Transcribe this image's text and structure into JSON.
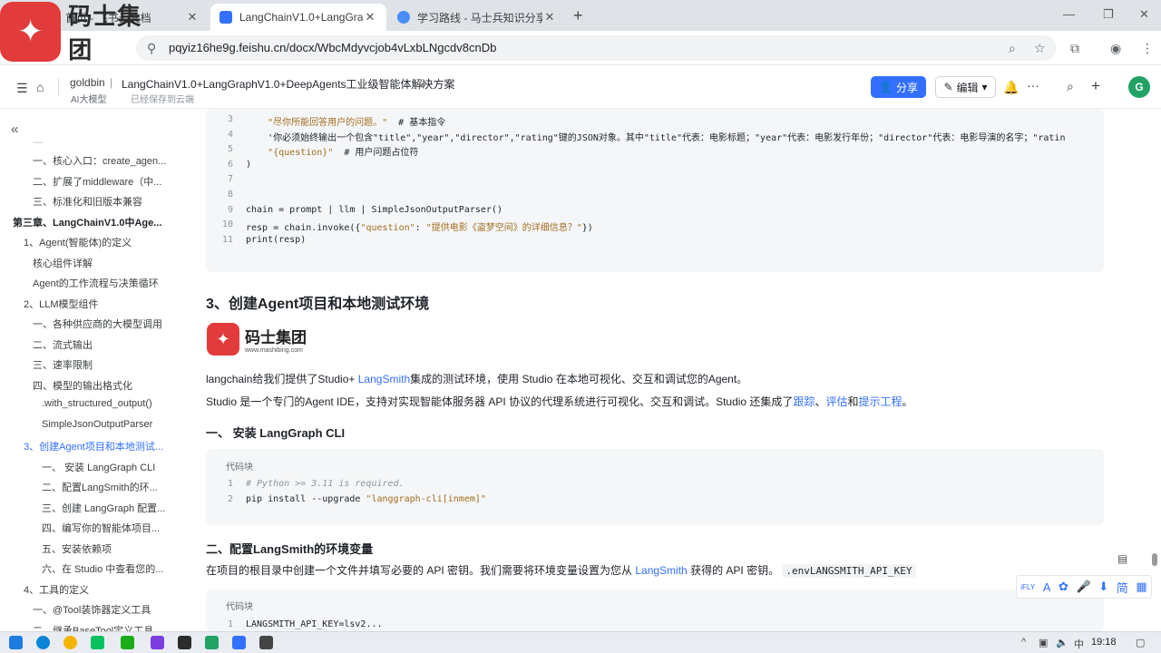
{
  "browser": {
    "tabs": [
      {
        "label": "首页 - 飞书云文档",
        "active": false
      },
      {
        "label": "LangChainV1.0+LangGraphV",
        "active": true
      },
      {
        "label": "学习路线 - 马士兵知识分享平台",
        "active": false
      }
    ],
    "new_tab": "+",
    "url": "pqyiz16he9g.feishu.cn/docx/WbcMdyvcjob4vLxbLNgcdv8cnDb"
  },
  "logo": {
    "text": "码士集团"
  },
  "header": {
    "breadcrumb_root": "goldbin",
    "doc_title": "LangChainV1.0+LangGraphV1.0+DeepAgents工业级智能体解决方案",
    "tag": "AI大模型",
    "save_status": "已经保存到云端",
    "share_label": "分享",
    "edit_label": "编辑",
    "avatar_letter": "G"
  },
  "sidebar": {
    "collapse_icon": "«",
    "items": [
      {
        "label": "一、核心入口：create_agen...",
        "level": 2
      },
      {
        "label": "二、扩展了middleware（中...",
        "level": 2
      },
      {
        "label": "三、标准化和旧版本兼容",
        "level": 2
      },
      {
        "label": "第三章、LangChainV1.0中Age...",
        "level": 0
      },
      {
        "label": "1、Agent(智能体)的定义",
        "level": 1
      },
      {
        "label": "核心组件详解",
        "level": 2
      },
      {
        "label": "Agent的工作流程与决策循环",
        "level": 2
      },
      {
        "label": "2、LLM模型组件",
        "level": 1
      },
      {
        "label": "一、各种供应商的大模型调用",
        "level": 2
      },
      {
        "label": "二、流式输出",
        "level": 2
      },
      {
        "label": "三、速率限制",
        "level": 2
      },
      {
        "label": "四、模型的输出格式化",
        "level": 2
      },
      {
        "label": ".with_structured_output()",
        "level": 3
      },
      {
        "label": "SimpleJsonOutputParser",
        "level": 3
      },
      {
        "label": "3、创建Agent项目和本地测试...",
        "level": 1
      },
      {
        "label": "一、 安装 LangGraph CLI",
        "level": 3
      },
      {
        "label": "二、配置LangSmith的环...",
        "level": 3
      },
      {
        "label": "三、创建 LangGraph 配置...",
        "level": 3
      },
      {
        "label": "四、编写你的智能体项目...",
        "level": 3
      },
      {
        "label": "五、安装依赖项",
        "level": 3
      },
      {
        "label": "六、在 Studio 中查看您的...",
        "level": 3
      },
      {
        "label": "4、工具的定义",
        "level": 1
      },
      {
        "label": "一、@Tool装饰器定义工具",
        "level": 2
      },
      {
        "label": "二、继承BaseTool定义工具",
        "level": 2
      }
    ]
  },
  "code1": {
    "lines": [
      {
        "n": "3",
        "parts": [
          {
            "t": "    ",
            "c": ""
          },
          {
            "t": "\"尽你所能回答用户的问题。\"",
            "c": "str"
          },
          {
            "t": "  # 基本指令",
            "c": ""
          }
        ]
      },
      {
        "n": "4",
        "parts": [
          {
            "t": "    '你必须始终输出一个包含\"title\",\"year\",\"director\",\"rating\"键的JSON对象。其中\"title\"代表：电影标题；\"year\"代表：电影发行年份；\"director\"代表：电影导演的名字；\"ratin",
            "c": ""
          }
        ]
      },
      {
        "n": "5",
        "parts": [
          {
            "t": "    ",
            "c": ""
          },
          {
            "t": "\"{question}\"",
            "c": "str"
          },
          {
            "t": "  # 用户问题占位符",
            "c": ""
          }
        ]
      },
      {
        "n": "6",
        "parts": [
          {
            "t": ")",
            "c": ""
          }
        ]
      },
      {
        "n": "7",
        "parts": [
          {
            "t": "",
            "c": ""
          }
        ]
      },
      {
        "n": "8",
        "parts": [
          {
            "t": "",
            "c": ""
          }
        ]
      },
      {
        "n": "9",
        "parts": [
          {
            "t": "chain = prompt | llm | SimpleJsonOutputParser()",
            "c": ""
          }
        ]
      },
      {
        "n": "10",
        "parts": [
          {
            "t": "resp = chain.invoke({",
            "c": ""
          },
          {
            "t": "\"question\"",
            "c": "str"
          },
          {
            "t": ": ",
            "c": ""
          },
          {
            "t": "\"提供电影《盗梦空间》的详细信息？\"",
            "c": "str"
          },
          {
            "t": "})",
            "c": ""
          }
        ]
      },
      {
        "n": "11",
        "parts": [
          {
            "t": "print(resp)",
            "c": ""
          }
        ]
      }
    ]
  },
  "section3": {
    "title": "3、创建Agent项目和本地测试环境",
    "brand_name": "码士集团",
    "brand_url": "www.mashibing.com",
    "p1_a": "langchain给我们提供了Studio+ ",
    "p1_link": "LangSmith",
    "p1_b": "集成的测试环境，使用 Studio 在本地可视化、交互和调试您的Agent。",
    "p2_a": "Studio 是一个专门的Agent IDE，支持对实现智能体服务器 API 协议的代理系统进行可视化、交互和调试。Studio 还集成了",
    "p2_l1": "跟踪",
    "p2_s1": "、",
    "p2_l2": "评估",
    "p2_s2": "和",
    "p2_l3": "提示工程",
    "p2_end": "。"
  },
  "sub1": {
    "title": "一、 安装 LangGraph CLI",
    "code_label": "代码块",
    "lines": [
      {
        "n": "1",
        "parts": [
          {
            "t": "# Python >= 3.11 is required.",
            "c": "cmt"
          }
        ]
      },
      {
        "n": "2",
        "parts": [
          {
            "t": "pip install --upgrade ",
            "c": ""
          },
          {
            "t": "\"langgraph-cli[inmem]\"",
            "c": "str"
          }
        ]
      }
    ]
  },
  "sub2": {
    "title": "二、配置LangSmith的环境变量",
    "p_a": "在项目的根目录中创建一个文件并填写必要的 API 密钥。我们需要将环境变量设置为您从 ",
    "p_link": "LangSmith",
    "p_b": " 获得的 API 密钥。 ",
    "p_code": ".envLANGSMITH_API_KEY",
    "code_label": "代码块",
    "lines": [
      {
        "n": "1",
        "parts": [
          {
            "t": "LANGSMITH_API_KEY=lsv2...",
            "c": ""
          }
        ]
      }
    ]
  },
  "floatbar": {
    "items": [
      "iFLY",
      "A",
      "✿",
      "🎤",
      "⬇",
      "简",
      "▦"
    ]
  },
  "taskbar": {
    "time": "19:18"
  },
  "colors": {
    "accent": "#3370ff",
    "brand_red": "#e23b3b"
  }
}
